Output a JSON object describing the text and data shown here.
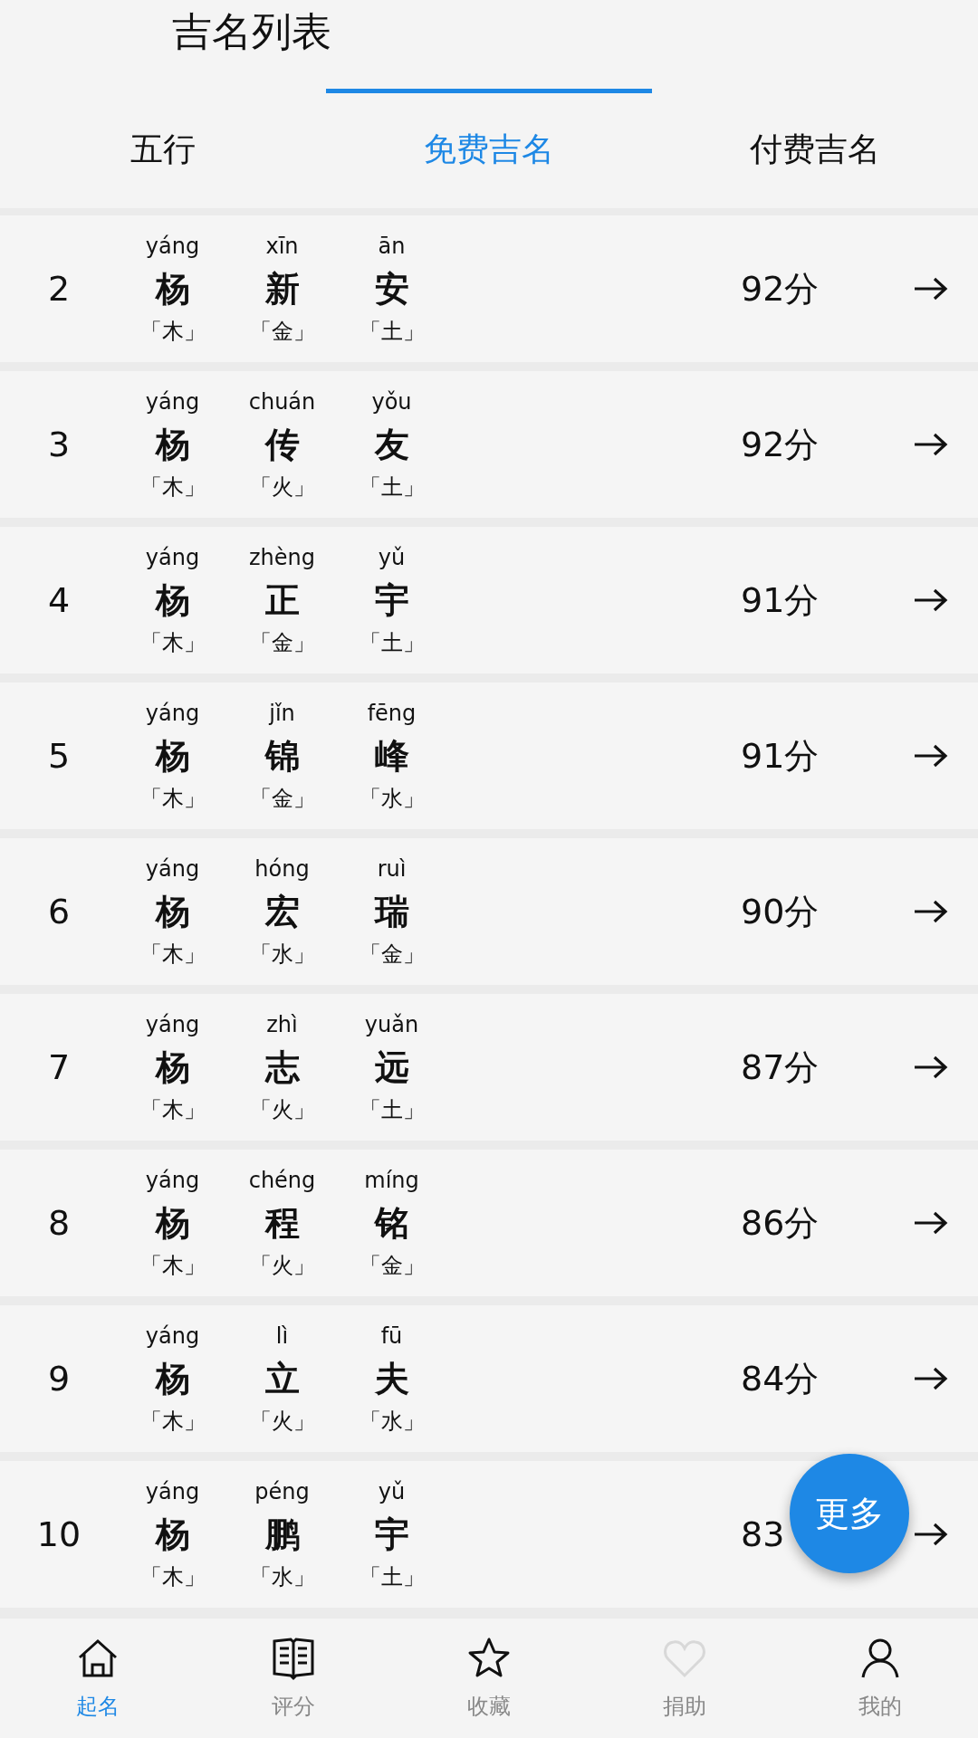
{
  "header": {
    "title": "吉名列表"
  },
  "tabs": [
    {
      "label": "五行",
      "selected": false
    },
    {
      "label": "免费吉名",
      "selected": true
    },
    {
      "label": "付费吉名",
      "selected": false
    }
  ],
  "rows": [
    {
      "rank": "2",
      "chars": [
        {
          "pinyin": "yáng",
          "hanzi": "杨",
          "element": "「木」"
        },
        {
          "pinyin": "xīn",
          "hanzi": "新",
          "element": "「金」"
        },
        {
          "pinyin": "ān",
          "hanzi": "安",
          "element": "「土」"
        }
      ],
      "score": "92分"
    },
    {
      "rank": "3",
      "chars": [
        {
          "pinyin": "yáng",
          "hanzi": "杨",
          "element": "「木」"
        },
        {
          "pinyin": "chuán",
          "hanzi": "传",
          "element": "「火」"
        },
        {
          "pinyin": "yǒu",
          "hanzi": "友",
          "element": "「土」"
        }
      ],
      "score": "92分"
    },
    {
      "rank": "4",
      "chars": [
        {
          "pinyin": "yáng",
          "hanzi": "杨",
          "element": "「木」"
        },
        {
          "pinyin": "zhèng",
          "hanzi": "正",
          "element": "「金」"
        },
        {
          "pinyin": "yǔ",
          "hanzi": "宇",
          "element": "「土」"
        }
      ],
      "score": "91分"
    },
    {
      "rank": "5",
      "chars": [
        {
          "pinyin": "yáng",
          "hanzi": "杨",
          "element": "「木」"
        },
        {
          "pinyin": "jǐn",
          "hanzi": "锦",
          "element": "「金」"
        },
        {
          "pinyin": "fēng",
          "hanzi": "峰",
          "element": "「水」"
        }
      ],
      "score": "91分"
    },
    {
      "rank": "6",
      "chars": [
        {
          "pinyin": "yáng",
          "hanzi": "杨",
          "element": "「木」"
        },
        {
          "pinyin": "hóng",
          "hanzi": "宏",
          "element": "「水」"
        },
        {
          "pinyin": "ruì",
          "hanzi": "瑞",
          "element": "「金」"
        }
      ],
      "score": "90分"
    },
    {
      "rank": "7",
      "chars": [
        {
          "pinyin": "yáng",
          "hanzi": "杨",
          "element": "「木」"
        },
        {
          "pinyin": "zhì",
          "hanzi": "志",
          "element": "「火」"
        },
        {
          "pinyin": "yuǎn",
          "hanzi": "远",
          "element": "「土」"
        }
      ],
      "score": "87分"
    },
    {
      "rank": "8",
      "chars": [
        {
          "pinyin": "yáng",
          "hanzi": "杨",
          "element": "「木」"
        },
        {
          "pinyin": "chéng",
          "hanzi": "程",
          "element": "「火」"
        },
        {
          "pinyin": "míng",
          "hanzi": "铭",
          "element": "「金」"
        }
      ],
      "score": "86分"
    },
    {
      "rank": "9",
      "chars": [
        {
          "pinyin": "yáng",
          "hanzi": "杨",
          "element": "「木」"
        },
        {
          "pinyin": "lì",
          "hanzi": "立",
          "element": "「火」"
        },
        {
          "pinyin": "fū",
          "hanzi": "夫",
          "element": "「水」"
        }
      ],
      "score": "84分"
    },
    {
      "rank": "10",
      "chars": [
        {
          "pinyin": "yáng",
          "hanzi": "杨",
          "element": "「木」"
        },
        {
          "pinyin": "péng",
          "hanzi": "鹏",
          "element": "「水」"
        },
        {
          "pinyin": "yǔ",
          "hanzi": "宇",
          "element": "「土」"
        }
      ],
      "score": "83"
    }
  ],
  "fab": {
    "label": "更多"
  },
  "nav": [
    {
      "kind": "home",
      "label": "起名",
      "selected": true
    },
    {
      "kind": "book",
      "label": "评分",
      "selected": false
    },
    {
      "kind": "star",
      "label": "收藏",
      "selected": false
    },
    {
      "kind": "heart",
      "label": "捐助",
      "selected": false
    },
    {
      "kind": "person",
      "label": "我的",
      "selected": false
    }
  ]
}
